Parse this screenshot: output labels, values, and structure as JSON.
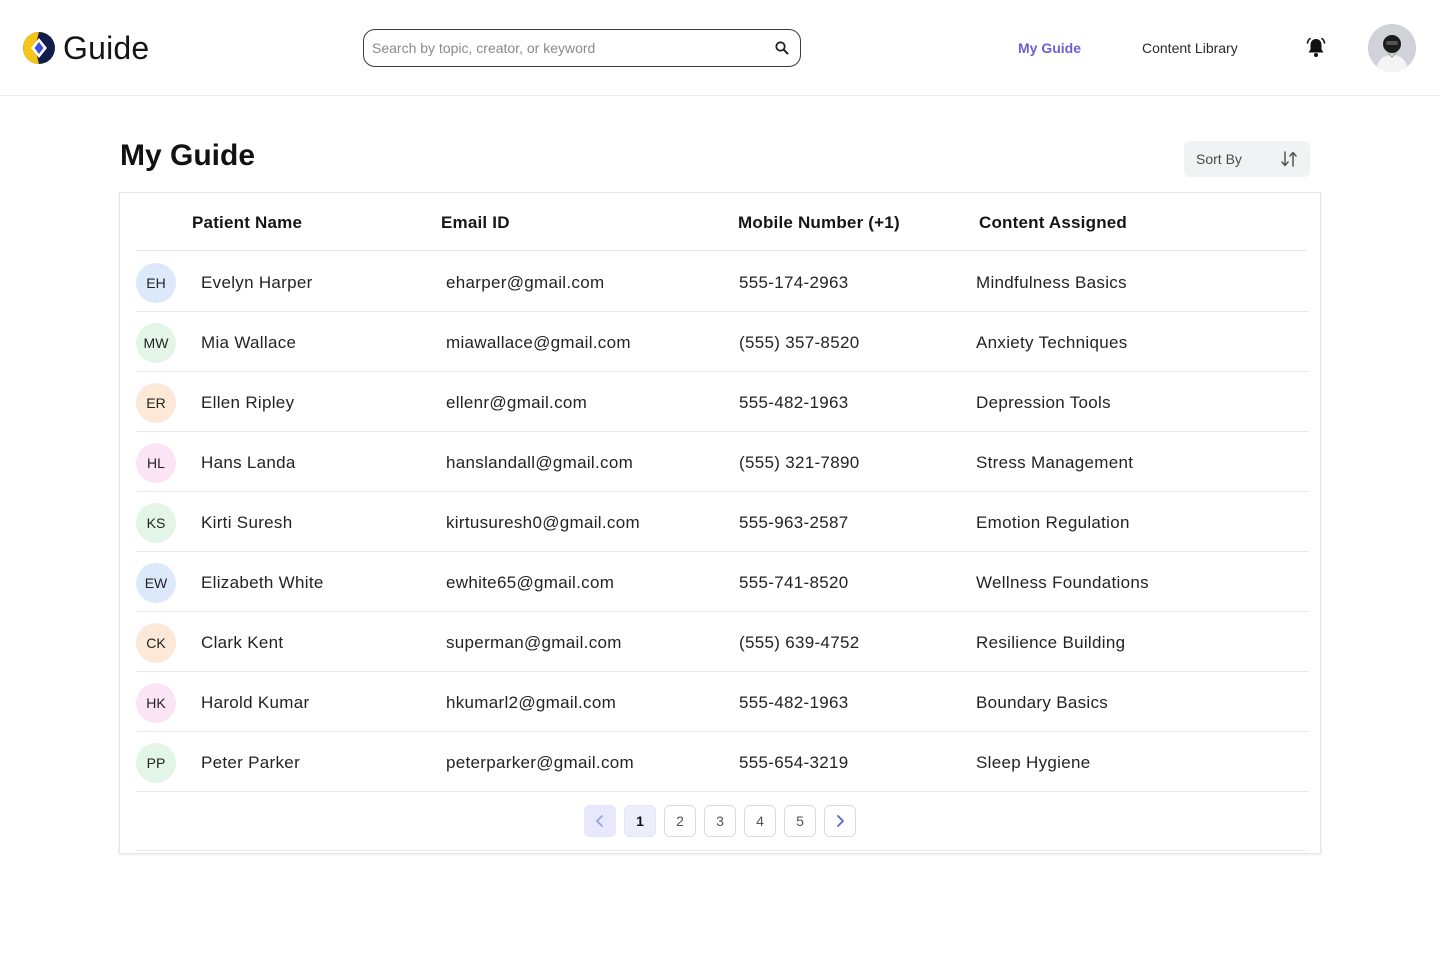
{
  "header": {
    "logo_text": "Guide",
    "search_placeholder": "Search by topic, creator, or keyword",
    "nav": {
      "my_guide": "My Guide",
      "content_library": "Content Library"
    },
    "icons": {
      "logo": "guide-logo",
      "search": "search-icon",
      "bell": "bell-icon",
      "avatar": "avatar"
    },
    "active_nav_color": "#6a5fd3"
  },
  "page": {
    "title": "My Guide",
    "sort_label": "Sort By"
  },
  "table": {
    "headers": [
      "Patient Name",
      "Email ID",
      "Mobile Number (+1)",
      "Content Assigned"
    ],
    "rows": [
      {
        "initials": "EH",
        "name": "Evelyn Harper",
        "email": "eharper@gmail.com",
        "mobile": "555-174-2963",
        "content": "Mindfulness Basics",
        "badge_color": "#dce9fb"
      },
      {
        "initials": "MW",
        "name": "Mia Wallace",
        "email": "miawallace@gmail.com",
        "mobile": "(555) 357-8520",
        "content": "Anxiety Techniques",
        "badge_color": "#e3f5e6"
      },
      {
        "initials": "ER",
        "name": "Ellen Ripley",
        "email": "ellenr@gmail.com",
        "mobile": "555-482-1963",
        "content": "Depression Tools",
        "badge_color": "#fbe8d6"
      },
      {
        "initials": "HL",
        "name": "Hans Landa",
        "email": "hanslandall@gmail.com",
        "mobile": "(555) 321-7890",
        "content": "Stress Management",
        "badge_color": "#fbe4f4"
      },
      {
        "initials": "KS",
        "name": "Kirti Suresh",
        "email": "kirtusuresh0@gmail.com",
        "mobile": "555-963-2587",
        "content": "Emotion Regulation",
        "badge_color": "#e3f5e6"
      },
      {
        "initials": "EW",
        "name": "Elizabeth White",
        "email": "ewhite65@gmail.com",
        "mobile": "555-741-8520",
        "content": "Wellness Foundations",
        "badge_color": "#dce9fb"
      },
      {
        "initials": "CK",
        "name": "Clark Kent",
        "email": "superman@gmail.com",
        "mobile": "(555) 639-4752",
        "content": "Resilience Building",
        "badge_color": "#fbe8d6"
      },
      {
        "initials": "HK",
        "name": "Harold Kumar",
        "email": "hkumarl2@gmail.com",
        "mobile": "555-482-1963",
        "content": "Boundary Basics",
        "badge_color": "#fbe4f4"
      },
      {
        "initials": "PP",
        "name": "Peter Parker",
        "email": "peterparker@gmail.com",
        "mobile": "555-654-3219",
        "content": "Sleep Hygiene",
        "badge_color": "#e3f5e6"
      }
    ]
  },
  "pagination": {
    "pages": [
      "1",
      "2",
      "3",
      "4",
      "5"
    ],
    "current": "1",
    "prev_icon": "chevron-left-icon",
    "next_icon": "chevron-right-icon"
  }
}
